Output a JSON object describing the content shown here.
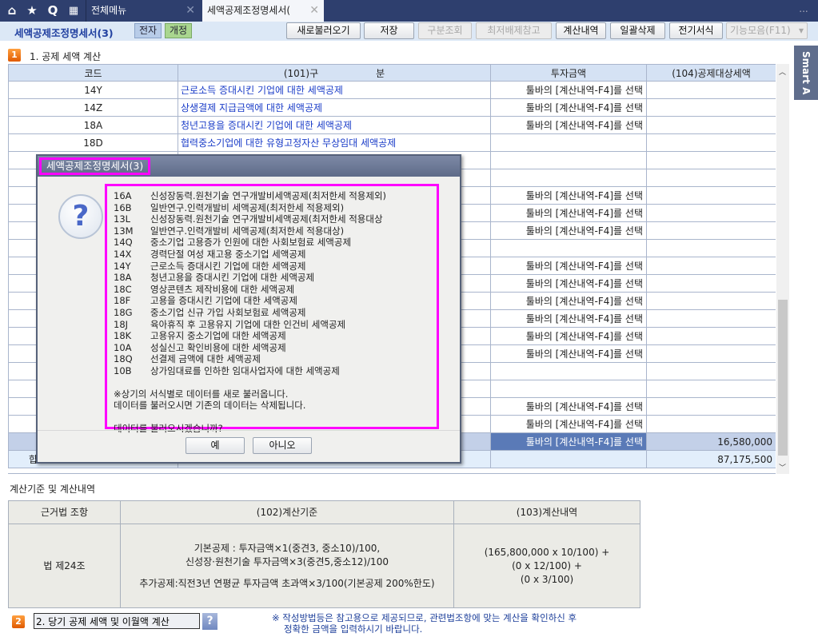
{
  "topbar": {
    "tabs": [
      {
        "label": "전체메뉴"
      },
      {
        "label": "세액공제조정명세서("
      }
    ],
    "more": "..."
  },
  "toolbar": {
    "title": "세액공제조정명세서(3)",
    "badge1": "전자",
    "badge2": "개정",
    "buttons": [
      "새로불러오기",
      "저장",
      "구분조회",
      "최저배제참고",
      "계산내역",
      "일괄삭제",
      "전기서식",
      "기능모음(F11)"
    ]
  },
  "smart": "Smart A",
  "section1": {
    "num": "1",
    "title": "1. 공제 세액 계산"
  },
  "grid": {
    "headers": [
      "코드",
      "(101)구　　　　　　분",
      "투자금액",
      "(104)공제대상세액"
    ],
    "rows": [
      {
        "code": "14Y",
        "name": "근로소득 증대시킨 기업에 대한 세액공제",
        "inv": "툴바의 [계산내역-F4]를 선택",
        "amt": ""
      },
      {
        "code": "14Z",
        "name": "상생결제 지급금액에 대한 세액공제",
        "inv": "툴바의 [계산내역-F4]를 선택",
        "amt": ""
      },
      {
        "code": "18A",
        "name": "청년고용을 증대시킨 기업에 대한 세액공제",
        "inv": "툴바의 [계산내역-F4]를 선택",
        "amt": ""
      },
      {
        "code": "18D",
        "name": "협력중소기업에 대한 유형고정자산 무상임대 세액공제",
        "inv": "",
        "amt": ""
      },
      {
        "code": "",
        "name": "",
        "inv": "",
        "amt": ""
      },
      {
        "code": "",
        "name": "",
        "inv": "",
        "amt": ""
      },
      {
        "code": "",
        "name": "",
        "inv": "툴바의 [계산내역-F4]를 선택",
        "amt": ""
      },
      {
        "code": "",
        "name": "",
        "inv": "툴바의 [계산내역-F4]를 선택",
        "amt": ""
      },
      {
        "code": "",
        "name": "",
        "inv": "툴바의 [계산내역-F4]를 선택",
        "amt": ""
      },
      {
        "code": "",
        "name": "",
        "inv": "",
        "amt": ""
      },
      {
        "code": "",
        "name": "",
        "inv": "툴바의 [계산내역-F4]를 선택",
        "amt": ""
      },
      {
        "code": "",
        "name": "",
        "inv": "툴바의 [계산내역-F4]를 선택",
        "amt": ""
      },
      {
        "code": "",
        "name": "",
        "inv": "툴바의 [계산내역-F4]를 선택",
        "amt": ""
      },
      {
        "code": "",
        "name": "",
        "inv": "툴바의 [계산내역-F4]를 선택",
        "amt": ""
      },
      {
        "code": "",
        "name": "",
        "inv": "툴바의 [계산내역-F4]를 선택",
        "amt": ""
      },
      {
        "code": "",
        "name": "",
        "inv": "툴바의 [계산내역-F4]를 선택",
        "amt": ""
      },
      {
        "code": "",
        "name": "",
        "inv": "",
        "amt": ""
      },
      {
        "code": "",
        "name": "",
        "inv": "",
        "amt": ""
      },
      {
        "code": "",
        "name": "",
        "inv": "툴바의 [계산내역-F4]를 선택",
        "amt": ""
      },
      {
        "code": "",
        "name": "",
        "inv": "툴바의 [계산내역-F4]를 선택",
        "amt": ""
      },
      {
        "code": "",
        "name": "",
        "inv": "툴바의 [계산내역-F4]를 선택",
        "amt": "16,580,000"
      }
    ],
    "total": {
      "label": "합",
      "amt": "87,175,500"
    }
  },
  "calc": {
    "title": "계산기준 및 계산내역",
    "headers": [
      "근거법 조항",
      "(102)계산기준",
      "(103)계산내역"
    ],
    "law": "법 제24조",
    "basis": [
      "기본공제 : 투자금액×1(중견3, 중소10)/100,",
      "신성장·원천기술 투자금액×3(중견5,중소12)/100",
      "",
      "추가공제:직전3년 연평균 투자금액 초과액×3/100(기본공제 200%한도)"
    ],
    "detail": [
      "(165,800,000 x 10/100) +",
      "(0 x 12/100) +",
      "(0 x 3/100)"
    ]
  },
  "section2": {
    "num": "2",
    "value": "2. 당기 공제 세액 및 이월액 계산",
    "help": "?",
    "note": [
      "※ 작성방법등은 참고용으로 제공되므로, 관련법조항에 맞는 계산을 확인하신 후",
      "정확한 금액을 입력하시기 바랍니다."
    ]
  },
  "dialog": {
    "title": "세액공제조정명세서(3)",
    "items": [
      [
        "16A",
        "신성장동력.원천기술 연구개발비세액공제(최저한세 적용제외)"
      ],
      [
        "16B",
        "일반연구.인력개발비 세액공제(최저한세 적용제외)"
      ],
      [
        "13L",
        "신성장동력.원천기술 연구개발비세액공제(최저한세 적용대상"
      ],
      [
        "13M",
        "일반연구.인력개발비 세액공제(최저한세 적용대상)"
      ],
      [
        "14Q",
        "중소기업 고용증가 인원에 대한 사회보험료 세액공제"
      ],
      [
        "14X",
        "경력단절 여성 재고용 중소기업 세액공제"
      ],
      [
        "14Y",
        "근로소득 증대시킨 기업에 대한 세액공제"
      ],
      [
        "18A",
        "청년고용을 증대시킨 기업에 대한 세액공제"
      ],
      [
        "18C",
        "영상콘텐츠 제작비용에 대한 세액공제"
      ],
      [
        "18F",
        "고용을 증대시킨 기업에 대한 세액공제"
      ],
      [
        "18G",
        "중소기업 신규 가입 사회보험료 세액공제"
      ],
      [
        "18J",
        "육아휴직 후 고용유지 기업에 대한 인건비 세액공제"
      ],
      [
        "18K",
        "고용유지 중소기업에 대한 세액공제"
      ],
      [
        "10A",
        "성실신고 확인비용에 대한 세액공제"
      ],
      [
        "18Q",
        "선결제 금액에 대한 세액공제"
      ],
      [
        "10B",
        "상가임대료를 인하한 임대사업자에 대한 세액공제"
      ]
    ],
    "notice1": "※상기의 서식별로 데이터를 새로 불러옵니다.",
    "notice2": "데이터를 불러오시면 기존의 데이터는 삭제됩니다.",
    "question": "데이터를 불러오시겠습니까?",
    "yes": "예",
    "no": "아니오"
  }
}
